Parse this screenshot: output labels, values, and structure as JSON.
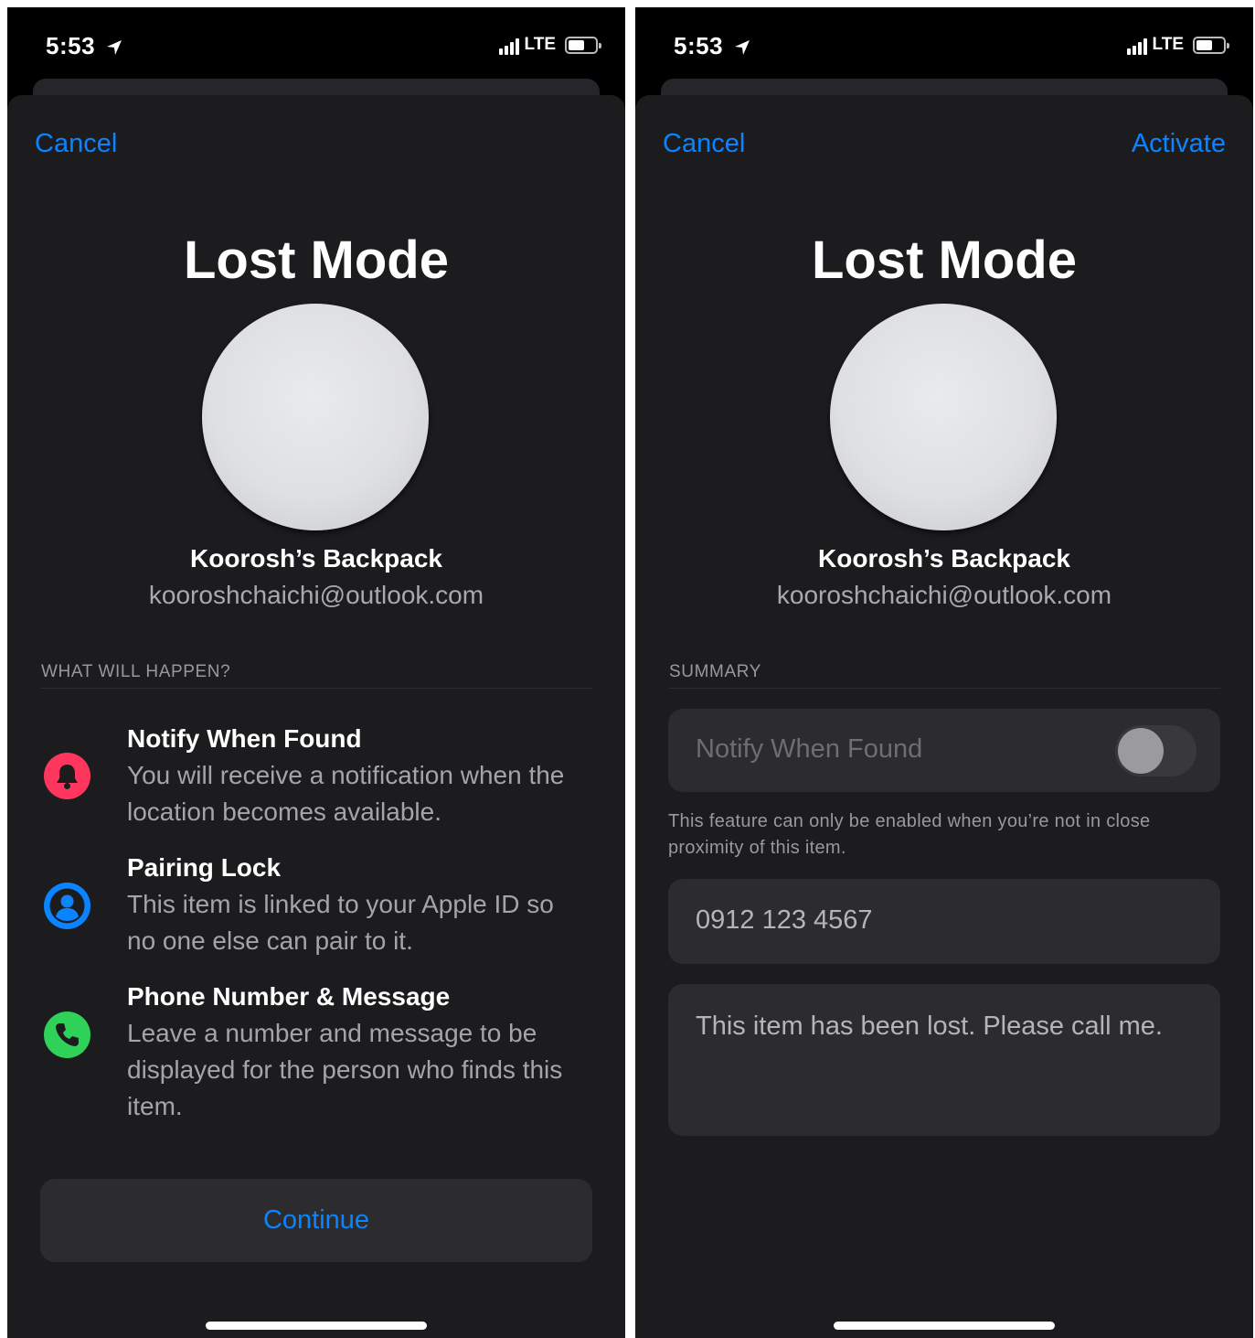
{
  "status_bar": {
    "time": "5:53",
    "network": "LTE"
  },
  "left_screen": {
    "cancel_label": "Cancel",
    "title": "Lost Mode",
    "item_name": "Koorosh’s Backpack",
    "item_email": "kooroshchaichi@outlook.com",
    "section_header": "WHAT WILL HAPPEN?",
    "features": [
      {
        "icon": "bell-icon",
        "color": "#ff375f",
        "title": "Notify When Found",
        "description": "You will receive a notification when the location becomes available."
      },
      {
        "icon": "person-icon",
        "color": "#0a84ff",
        "title": "Pairing Lock",
        "description": "This item is linked to your Apple ID so no one else can pair to it."
      },
      {
        "icon": "phone-icon",
        "color": "#30d158",
        "title": "Phone Number & Message",
        "description": "Leave a number and message to be displayed for the person who finds this item."
      }
    ],
    "continue_label": "Continue"
  },
  "right_screen": {
    "cancel_label": "Cancel",
    "activate_label": "Activate",
    "title": "Lost Mode",
    "item_name": "Koorosh’s Backpack",
    "item_email": "kooroshchaichi@outlook.com",
    "section_header": "SUMMARY",
    "notify_label": "Notify When Found",
    "notify_enabled": false,
    "notify_footnote": "This feature can only be enabled when you’re not in close proximity of this item.",
    "phone_number": "0912 123 4567",
    "message": "This item has been lost. Please call me."
  },
  "colors": {
    "accent": "#0a84ff",
    "sheet_background": "#1c1c1e",
    "card_background": "#2c2c2e"
  }
}
